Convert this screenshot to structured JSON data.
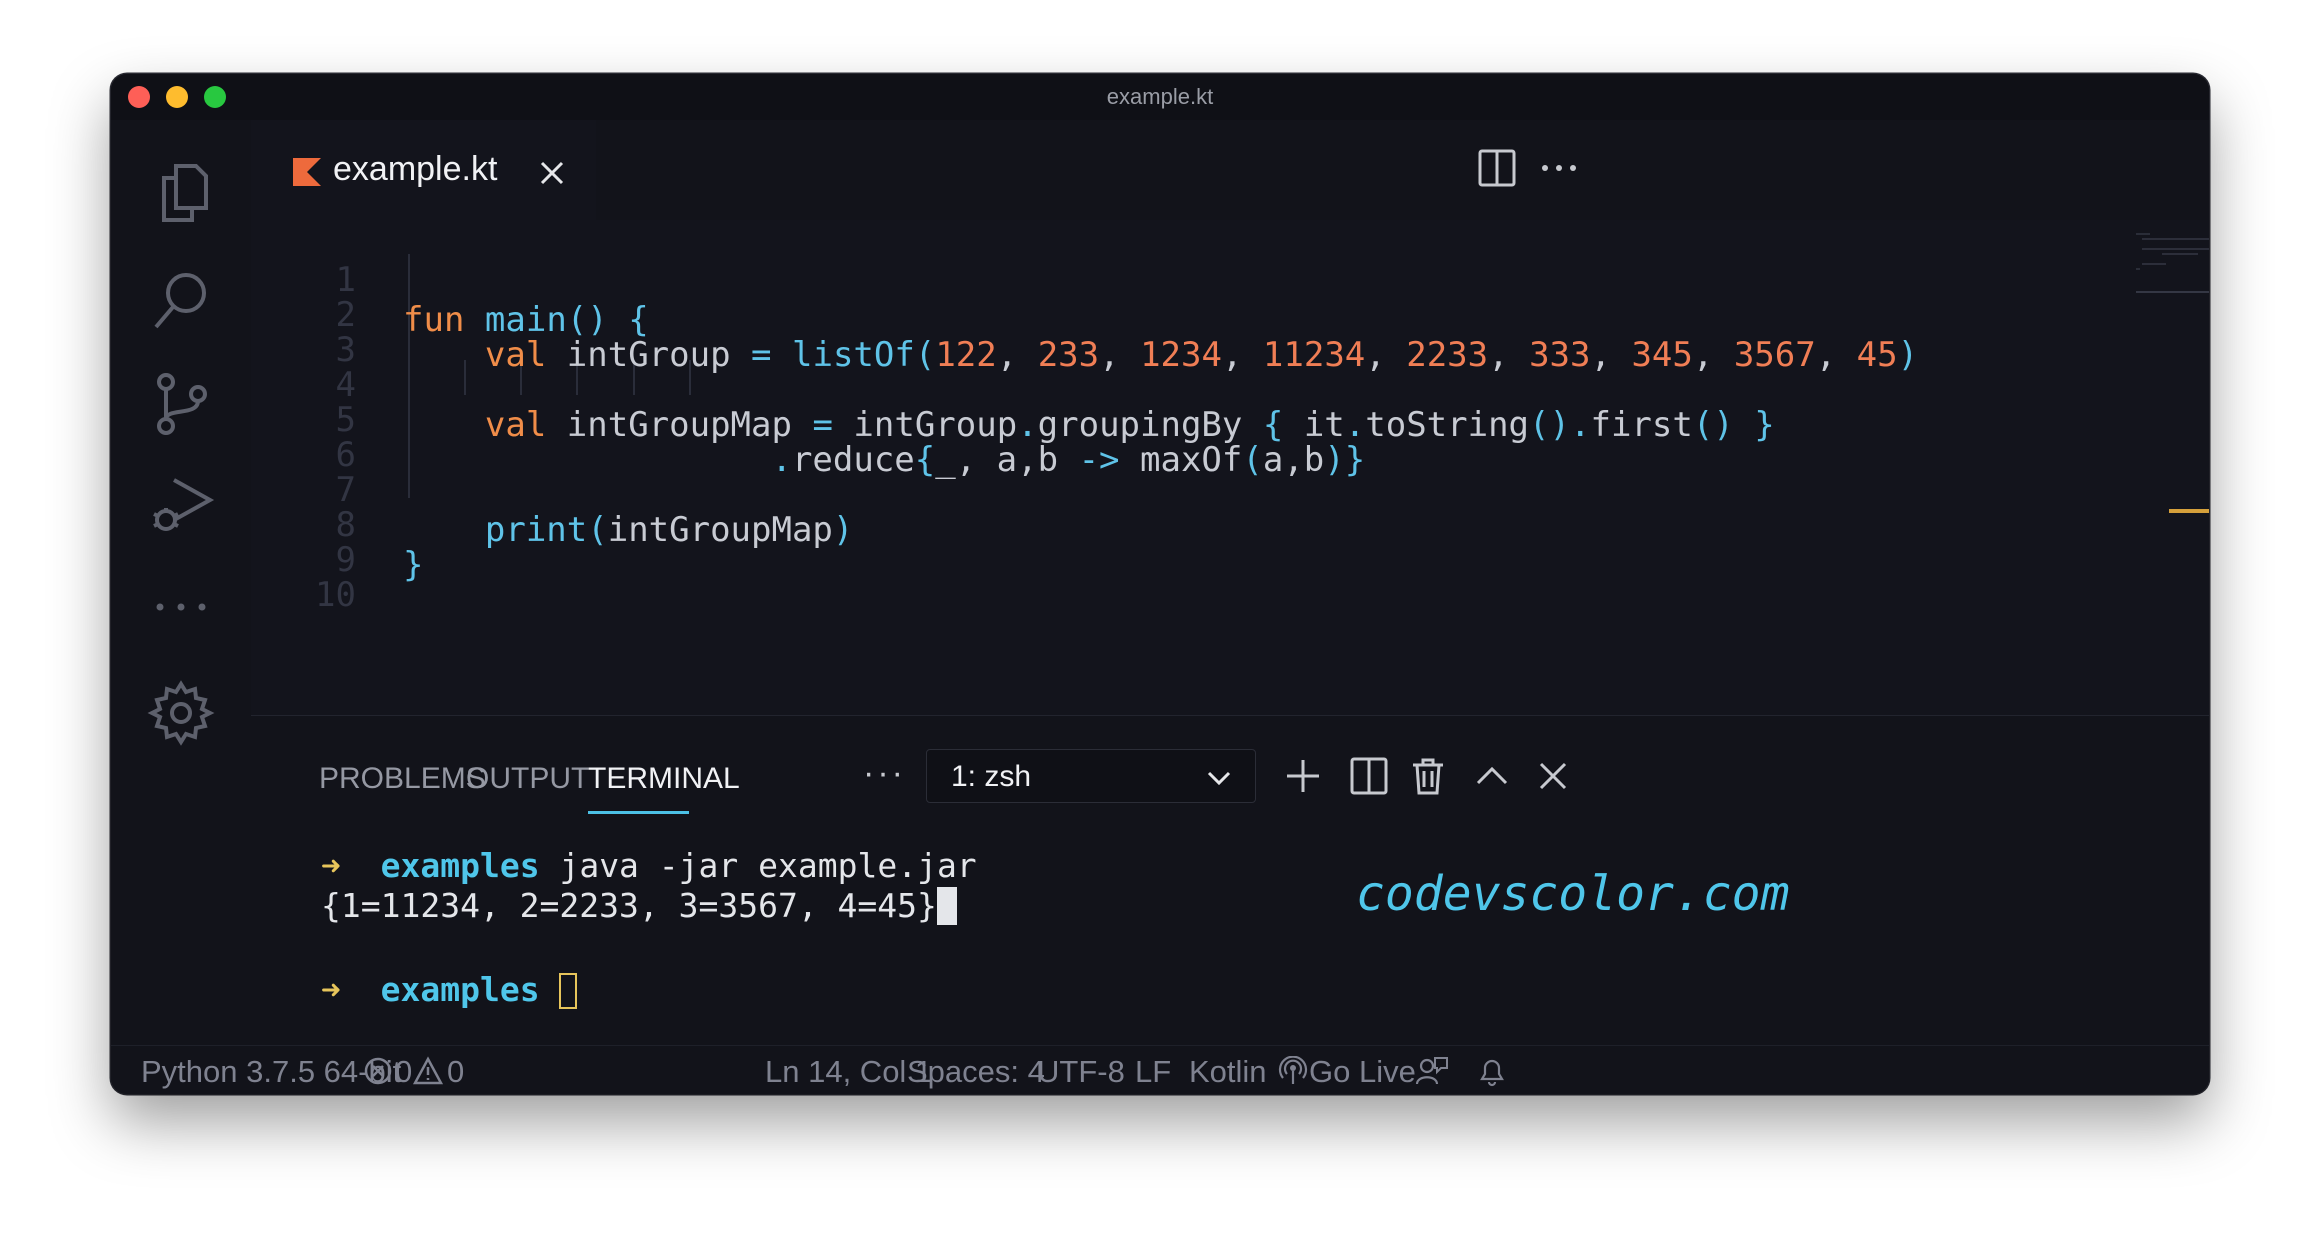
{
  "window": {
    "title": "example.kt"
  },
  "editor": {
    "tab": {
      "filename": "example.kt"
    },
    "line_numbers": [
      "1",
      "2",
      "3",
      "4",
      "5",
      "6",
      "7",
      "8",
      "9",
      "10"
    ],
    "code": {
      "l1": {
        "kw": "fun",
        "fn": "main",
        "paren": "()",
        "brace": "{"
      },
      "l2": {
        "kw": "val",
        "var": "intGroup",
        "eq": "=",
        "fn": "listOf",
        "nums": [
          "122",
          "233",
          "1234",
          "11234",
          "2233",
          "333",
          "345",
          "3567",
          "45"
        ]
      },
      "l4": {
        "kw": "val",
        "var": "intGroupMap",
        "eq": "=",
        "recv": "intGroup",
        "fn": "groupingBy",
        "it": "it",
        "fn2": "toString",
        "fn3": "first"
      },
      "l5": {
        "fn": "reduce",
        "params": "_, a,b",
        "arrow": "->",
        "fn2": "maxOf",
        "args": "a,b"
      },
      "l7": {
        "fn": "print",
        "arg": "intGroupMap"
      },
      "l8": {
        "brace": "}"
      }
    }
  },
  "panel": {
    "tabs": {
      "problems": "PROBLEMS",
      "output": "OUTPUT",
      "terminal": "TERMINAL"
    },
    "more": "···",
    "terminal_select": "1: zsh",
    "terminal": {
      "prompt_arrow": "➜",
      "dir": "examples",
      "command": "java -jar example.jar",
      "output": "{1=11234, 2=2233, 3=3567, 4=45}",
      "percent": "%"
    },
    "watermark": "codevscolor.com"
  },
  "statusbar": {
    "python": "Python 3.7.5 64-bit",
    "errors": "0",
    "warnings": "0",
    "position": "Ln 14, Col 1",
    "spaces": "Spaces: 4",
    "encoding": "UTF-8",
    "eol": "LF",
    "language": "Kotlin",
    "golive": "Go Live"
  },
  "colors": {
    "background": "#13141c",
    "keyword": "#f08d49",
    "function": "#5fc3e8",
    "number": "#f07e55",
    "accent": "#4fc6ea",
    "prompt": "#e7c55b"
  },
  "icons": {
    "activity": [
      "files-icon",
      "search-icon",
      "source-control-icon",
      "run-debug-icon",
      "more-icon",
      "gear-icon"
    ],
    "editor_actions": [
      "split-editor-icon",
      "more-icon"
    ],
    "panel_actions": [
      "chevron-down-icon",
      "plus-icon",
      "split-terminal-icon",
      "trash-icon",
      "chevron-up-icon",
      "close-icon"
    ],
    "status": [
      "error-icon",
      "warning-icon",
      "broadcast-icon",
      "feedback-icon",
      "bell-icon"
    ]
  }
}
